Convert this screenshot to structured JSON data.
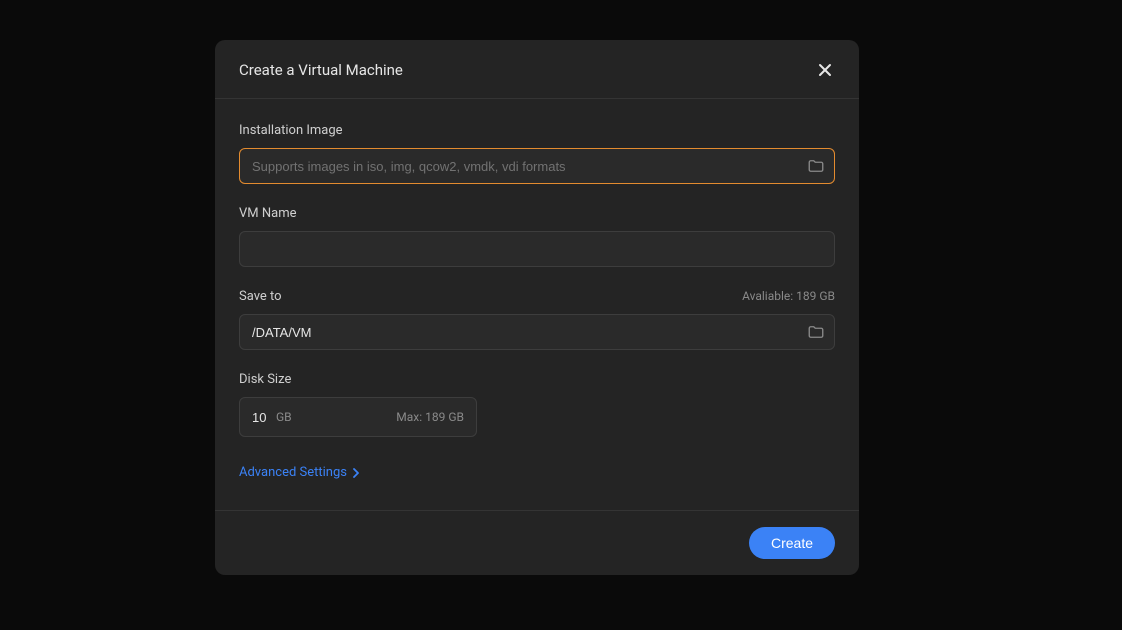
{
  "modal": {
    "title": "Create a Virtual Machine"
  },
  "install_image": {
    "label": "Installation Image",
    "placeholder": "Supports images in iso, img, qcow2, vmdk, vdi formats",
    "value": ""
  },
  "vm_name": {
    "label": "VM Name",
    "value": ""
  },
  "save_to": {
    "label": "Save to",
    "available": "Avaliable: 189 GB",
    "value": "/DATA/VM"
  },
  "disk_size": {
    "label": "Disk Size",
    "value": "10",
    "unit": "GB",
    "max": "Max: 189 GB"
  },
  "advanced": {
    "label": "Advanced Settings"
  },
  "footer": {
    "create": "Create"
  }
}
